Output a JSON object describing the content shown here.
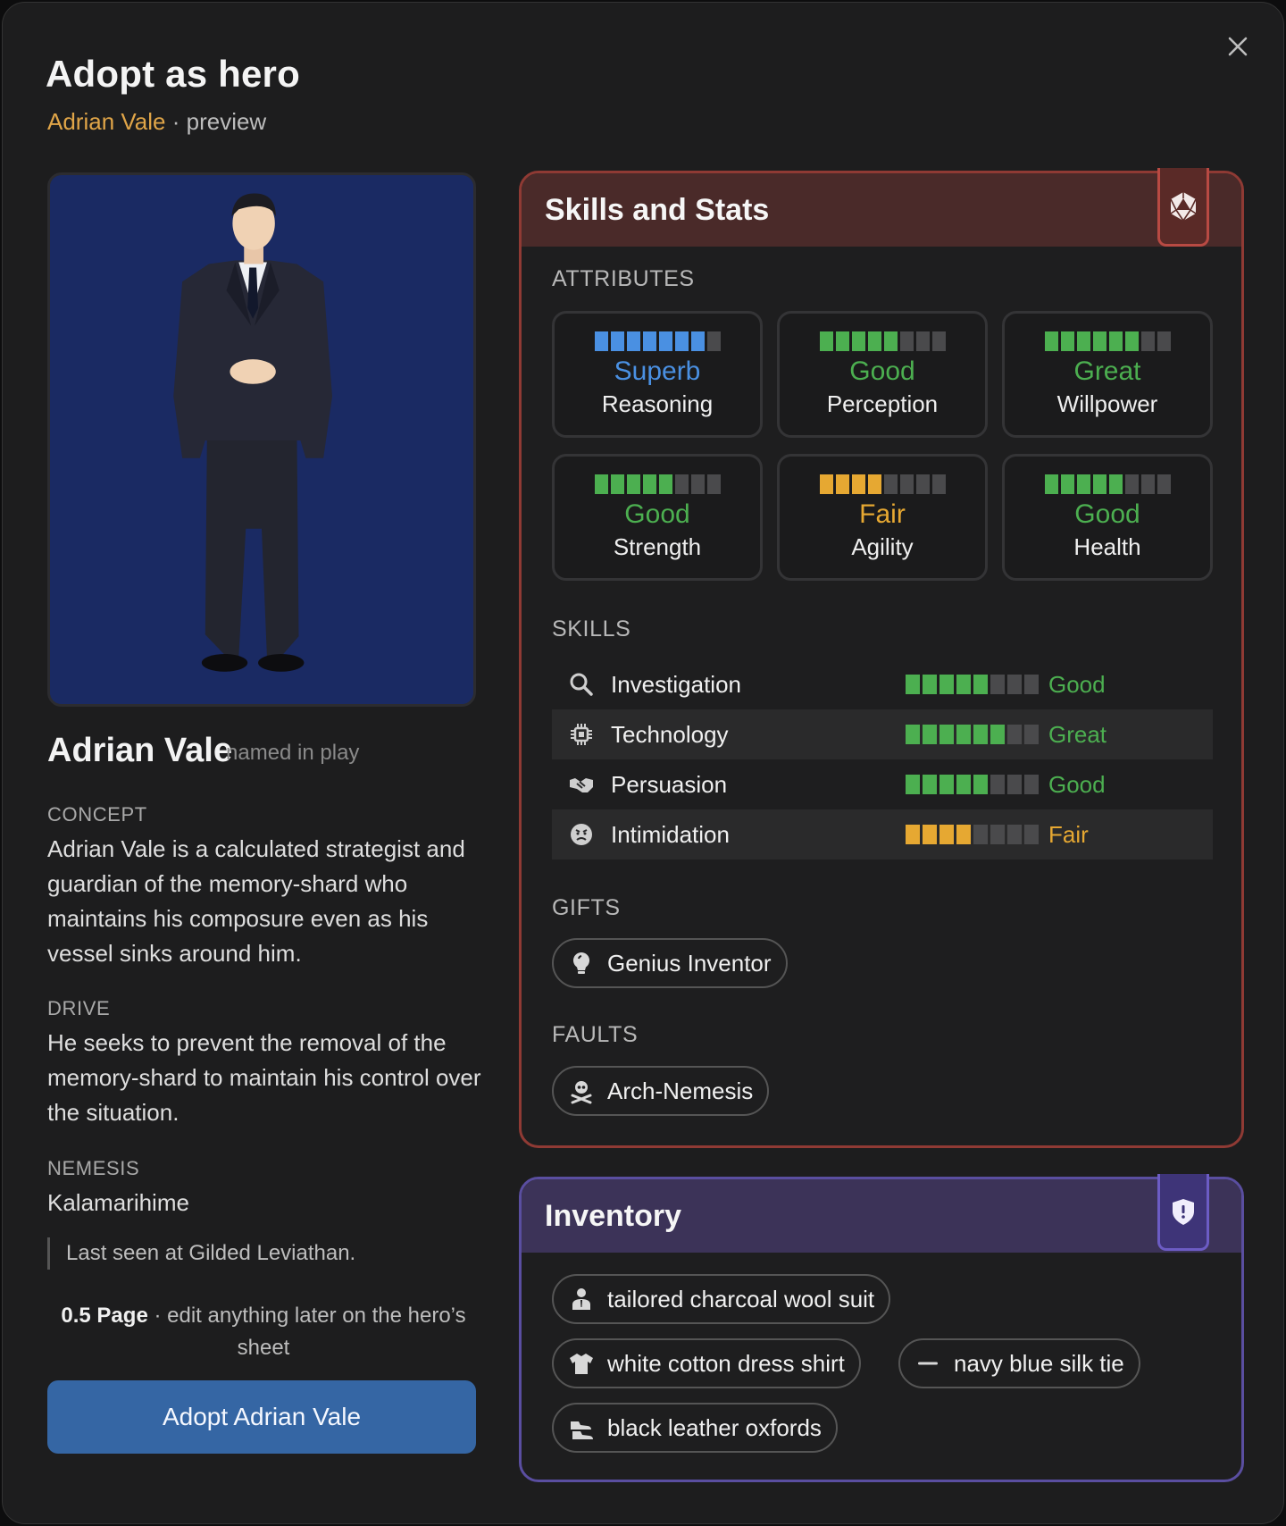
{
  "dialog": {
    "title": "Adopt as hero",
    "hero_name": "Adrian Vale",
    "preview_suffix": "· preview",
    "close_icon": "close-icon"
  },
  "hero": {
    "name": "Adrian Vale",
    "named_tag": "named in play",
    "concept_label": "CONCEPT",
    "concept": "Adrian Vale is a calculated strategist and guardian of the memory-shard who maintains his composure even as his vessel sinks around him.",
    "drive_label": "DRIVE",
    "drive": "He seeks to prevent the removal of the memory-shard to maintain his control over the situation.",
    "nemesis_label": "NEMESIS",
    "nemesis": "Kalamarihime",
    "last_seen": "Last seen at Gilded Leviathan.",
    "pages_value": "0.5 Page",
    "pages_note": "· edit anything later on the hero’s sheet",
    "adopt_button": "Adopt Adrian Vale"
  },
  "skills_panel": {
    "title": "Skills and Stats",
    "tab_icon": "d20-dice-icon",
    "attributes_label": "ATTRIBUTES",
    "attributes": [
      {
        "rank": "Superb",
        "name": "Reasoning",
        "level": 7,
        "max": 8,
        "color": "#4a90e2"
      },
      {
        "rank": "Good",
        "name": "Perception",
        "level": 5,
        "max": 8,
        "color": "#4caf50"
      },
      {
        "rank": "Great",
        "name": "Willpower",
        "level": 6,
        "max": 8,
        "color": "#4caf50"
      },
      {
        "rank": "Good",
        "name": "Strength",
        "level": 5,
        "max": 8,
        "color": "#4caf50"
      },
      {
        "rank": "Fair",
        "name": "Agility",
        "level": 4,
        "max": 8,
        "color": "#e6a832"
      },
      {
        "rank": "Good",
        "name": "Health",
        "level": 5,
        "max": 8,
        "color": "#4caf50"
      }
    ],
    "skills_label": "SKILLS",
    "skills": [
      {
        "name": "Investigation",
        "icon": "magnifier-icon",
        "rank": "Good",
        "level": 5,
        "max": 8,
        "color": "#4caf50"
      },
      {
        "name": "Technology",
        "icon": "chip-icon",
        "rank": "Great",
        "level": 6,
        "max": 8,
        "color": "#4caf50"
      },
      {
        "name": "Persuasion",
        "icon": "handshake-icon",
        "rank": "Good",
        "level": 5,
        "max": 8,
        "color": "#4caf50"
      },
      {
        "name": "Intimidation",
        "icon": "angry-face-icon",
        "rank": "Fair",
        "level": 4,
        "max": 8,
        "color": "#e6a832"
      }
    ],
    "gifts_label": "GIFTS",
    "gifts": [
      {
        "label": "Genius Inventor",
        "icon": "lightbulb-icon"
      }
    ],
    "faults_label": "FAULTS",
    "faults": [
      {
        "label": "Arch-Nemesis",
        "icon": "skull-icon"
      }
    ]
  },
  "inventory_panel": {
    "title": "Inventory",
    "tab_icon": "shield-icon",
    "items": [
      {
        "label": "tailored charcoal wool suit",
        "icon": "person-icon"
      },
      {
        "label": "white cotton dress shirt",
        "icon": "shirt-icon"
      },
      {
        "label": "navy blue silk tie",
        "icon": "dash-icon"
      },
      {
        "label": "black leather oxfords",
        "icon": "shoes-icon"
      }
    ]
  }
}
